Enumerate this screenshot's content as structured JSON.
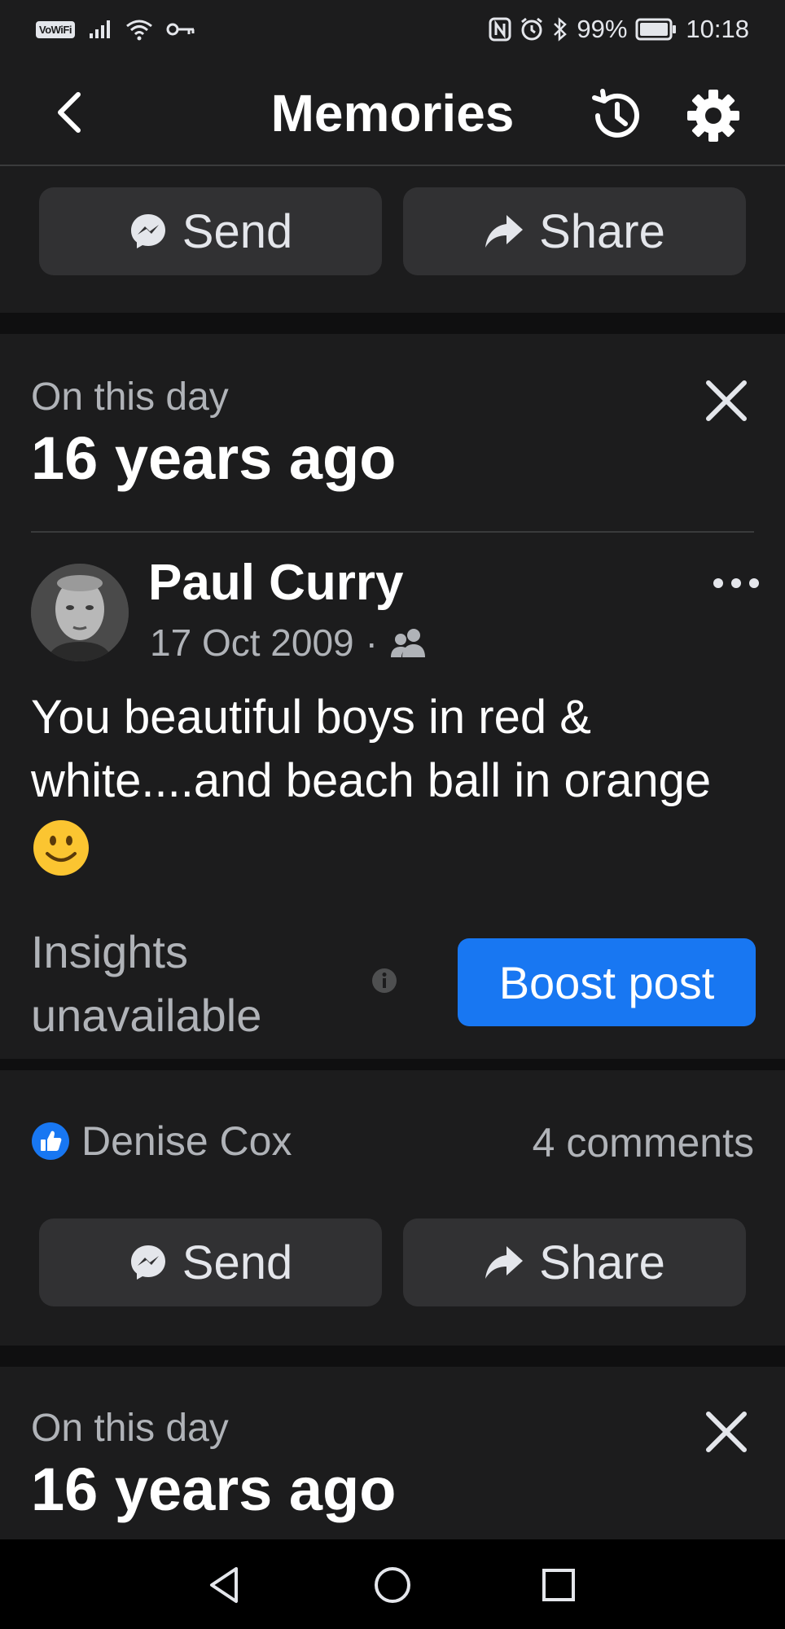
{
  "status_bar": {
    "left_badge": "VoWiFi",
    "battery": "99%",
    "time": "10:18"
  },
  "header": {
    "title": "Memories"
  },
  "top_actions": {
    "send_label": "Send",
    "share_label": "Share"
  },
  "memory_cards": [
    {
      "label": "On this day",
      "years_ago": "16 years ago",
      "post": {
        "author": "Paul Curry",
        "date": "17 Oct 2009",
        "separator": "·",
        "text": "You beautiful boys in red & white....and beach ball in orange",
        "insights_text": "Insights unavailable",
        "boost_label": "Boost post",
        "reactor_name": "Denise Cox",
        "comments_count": "4 comments",
        "send_label": "Send",
        "share_label": "Share"
      }
    },
    {
      "label": "On this day",
      "years_ago": "16 years ago"
    }
  ],
  "colors": {
    "background": "#1c1c1d",
    "button": "#313133",
    "accent": "#1877f2",
    "secondary_text": "#b0b3b8"
  },
  "icons": [
    "back-arrow-icon",
    "history-icon",
    "gear-icon",
    "messenger-icon",
    "share-arrow-icon",
    "close-icon",
    "more-icon",
    "friends-audience-icon",
    "smiley-emoji-icon",
    "info-icon",
    "like-icon"
  ]
}
